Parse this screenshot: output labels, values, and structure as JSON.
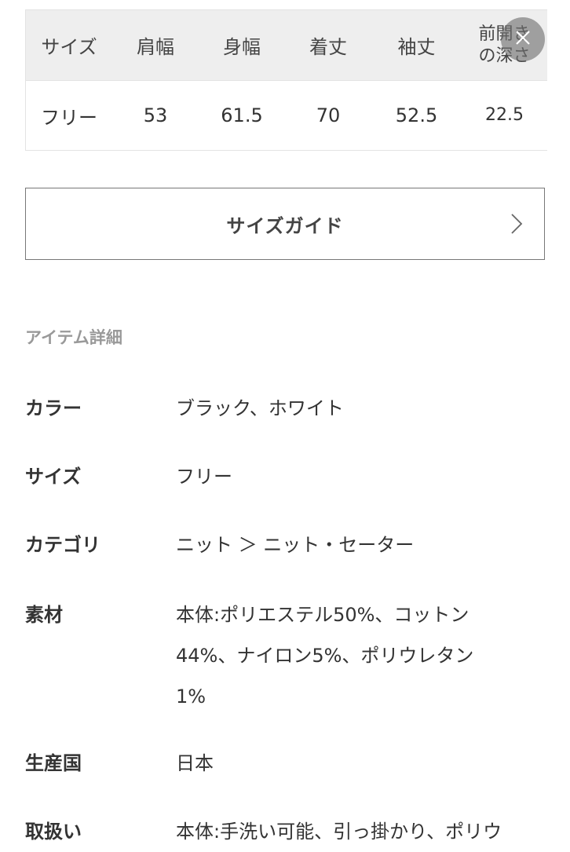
{
  "size_table": {
    "headers": [
      "サイズ",
      "肩幅",
      "身幅",
      "着丈",
      "袖丈",
      "前開き",
      "の深さ"
    ],
    "row": [
      "フリー",
      "53",
      "61.5",
      "70",
      "52.5",
      "22.5"
    ]
  },
  "size_guide": {
    "label": "サイズガイド"
  },
  "details": {
    "title": "アイテム詳細",
    "rows": [
      {
        "key": "カラー",
        "value": "ブラック、ホワイト"
      },
      {
        "key": "サイズ",
        "value": "フリー"
      },
      {
        "key": "カテゴリ",
        "value": "ニット ＞ ニット・セーター"
      },
      {
        "key": "素材",
        "value_lines": [
          "本体:ポリエステル50%、コットン",
          "44%、ナイロン5%、ポリウレタン",
          "1%"
        ]
      },
      {
        "key": "生産国",
        "value": "日本"
      },
      {
        "key": "取扱い",
        "value": "本体:手洗い可能、引っ掛かり、ポリウ"
      }
    ]
  },
  "icons": {
    "close": "close-icon",
    "chevron": "chevron-right-icon"
  }
}
